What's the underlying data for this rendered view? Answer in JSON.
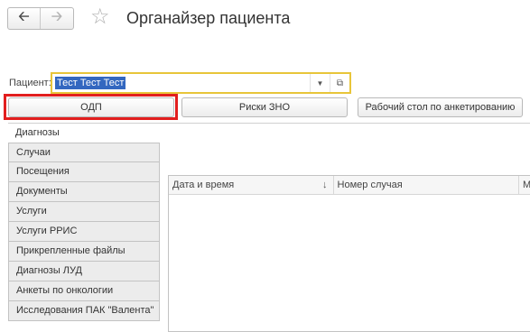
{
  "window": {
    "title": "Органайзер пациента",
    "back_icon": "arrow-left-icon",
    "forward_icon": "arrow-right-icon",
    "favorite_icon": "star-icon"
  },
  "patient": {
    "label": "Пациент:",
    "value": "Тест Тест Тест"
  },
  "buttons": {
    "odp": "ОДП",
    "risks": "Риски ЗНО",
    "desk": "Рабочий стол по анкетированию"
  },
  "tabs": [
    {
      "label": "Диагнозы",
      "active": true
    },
    {
      "label": "Случаи"
    },
    {
      "label": "Посещения"
    },
    {
      "label": "Документы"
    },
    {
      "label": "Услуги"
    },
    {
      "label": "Услуги РРИС"
    },
    {
      "label": "Прикрепленные файлы"
    },
    {
      "label": "Диагнозы ЛУД"
    },
    {
      "label": "Анкеты по онкологии"
    },
    {
      "label": "Исследования ПАК \"Валента\""
    }
  ],
  "table": {
    "columns": [
      "Дата и время",
      "Номер случая",
      "М"
    ],
    "rows": []
  },
  "colors": {
    "highlight_outline": "#e21e1e",
    "field_focus": "#e8c53a",
    "selection": "#3367c0"
  }
}
